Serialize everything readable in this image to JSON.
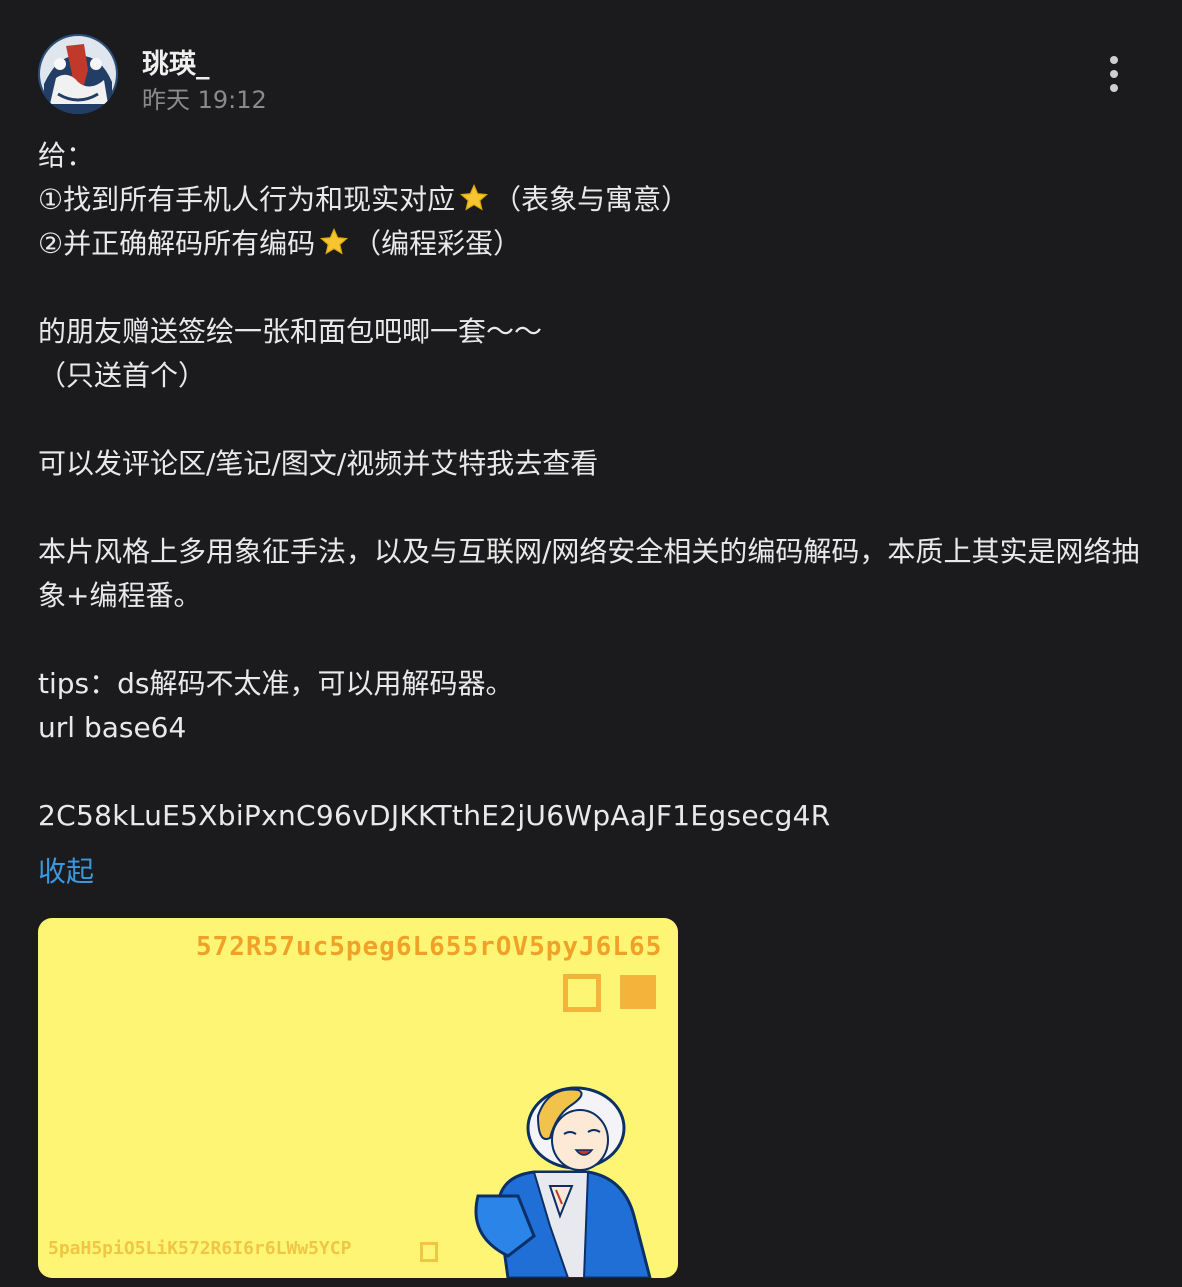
{
  "post": {
    "author": "珧瑛_",
    "time": "昨天 19:12",
    "menu_icon": "more-vertical-icon",
    "lines": {
      "l1": "给：",
      "l2a": "①找到所有手机人行为和现实对应",
      "l2b": "（表象与寓意）",
      "l3a": "②并正确解码所有编码",
      "l3b": "（编程彩蛋）",
      "l4": "的朋友赠送签绘一张和面包吧唧一套～～",
      "l5": "（只送首个）",
      "l6": "可以发评论区/笔记/图文/视频并艾特我去查看",
      "l7": "本片风格上多用象征手法，以及与互联网/网络安全相关的编码解码，本质上其实是网络抽象+编程番。",
      "l8": "tips：ds解码不太准，可以用解码器。",
      "l9": "url  base64",
      "l10": "2C58kLuE5XbiPxnC96vDJKKTthE2jU6WpAaJF1Egsecg4R"
    },
    "star_icon": "star-icon",
    "collapse_label": "收起"
  },
  "image": {
    "top_code": "572R57uc5peg6L655rOV5pyJ6L65",
    "bottom_code": "5paH5piO5LiK572R6I6r6LWw5YCP",
    "colors": {
      "background": "#fff575",
      "code_top": "#f2a128",
      "code_bottom": "#f2c545"
    }
  }
}
